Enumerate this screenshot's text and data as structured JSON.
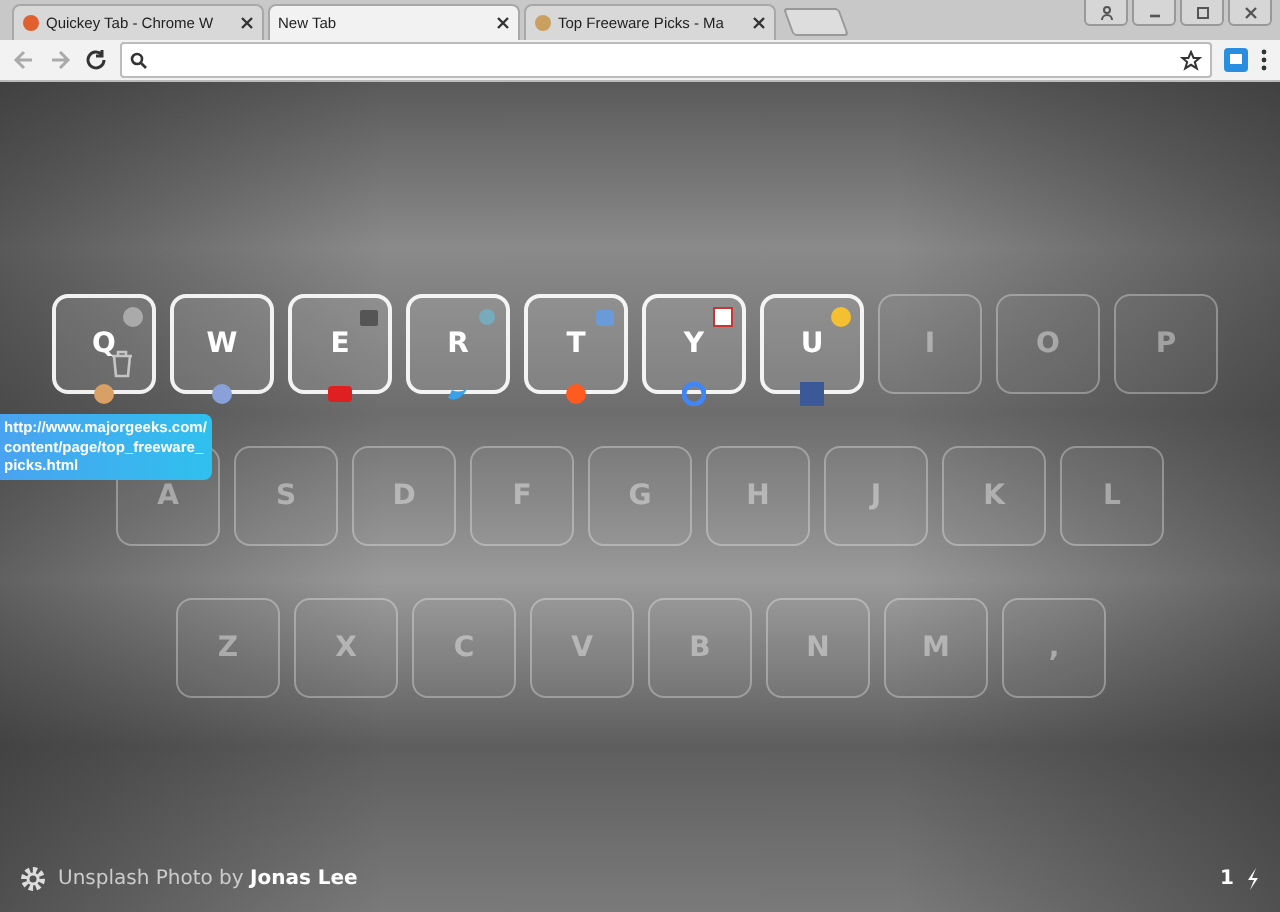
{
  "tabs": [
    {
      "title": "Quickey Tab - Chrome W",
      "selected": false
    },
    {
      "title": "New Tab",
      "selected": true
    },
    {
      "title": "Top Freeware Picks - Ma",
      "selected": false
    }
  ],
  "keyboard": [
    [
      {
        "letter": "Q",
        "assigned": true,
        "hovered": true
      },
      {
        "letter": "W",
        "assigned": true,
        "hovered": false
      },
      {
        "letter": "E",
        "assigned": true,
        "hovered": false
      },
      {
        "letter": "R",
        "assigned": true,
        "hovered": false
      },
      {
        "letter": "T",
        "assigned": true,
        "hovered": false
      },
      {
        "letter": "Y",
        "assigned": true,
        "hovered": false
      },
      {
        "letter": "U",
        "assigned": true,
        "hovered": false
      },
      {
        "letter": "I",
        "assigned": false,
        "hovered": false
      },
      {
        "letter": "O",
        "assigned": false,
        "hovered": false
      },
      {
        "letter": "P",
        "assigned": false,
        "hovered": false
      }
    ],
    [
      {
        "letter": "A",
        "assigned": false,
        "hovered": false
      },
      {
        "letter": "S",
        "assigned": false,
        "hovered": false
      },
      {
        "letter": "D",
        "assigned": false,
        "hovered": false
      },
      {
        "letter": "F",
        "assigned": false,
        "hovered": false
      },
      {
        "letter": "G",
        "assigned": false,
        "hovered": false
      },
      {
        "letter": "H",
        "assigned": false,
        "hovered": false
      },
      {
        "letter": "J",
        "assigned": false,
        "hovered": false
      },
      {
        "letter": "K",
        "assigned": false,
        "hovered": false
      },
      {
        "letter": "L",
        "assigned": false,
        "hovered": false
      }
    ],
    [
      {
        "letter": "Z",
        "assigned": false,
        "hovered": false
      },
      {
        "letter": "X",
        "assigned": false,
        "hovered": false
      },
      {
        "letter": "C",
        "assigned": false,
        "hovered": false
      },
      {
        "letter": "V",
        "assigned": false,
        "hovered": false
      },
      {
        "letter": "B",
        "assigned": false,
        "hovered": false
      },
      {
        "letter": "N",
        "assigned": false,
        "hovered": false
      },
      {
        "letter": "M",
        "assigned": false,
        "hovered": false
      },
      {
        "letter": ",",
        "assigned": false,
        "hovered": false
      }
    ]
  ],
  "tooltip": "http://www.majorgeeks.com/content/page/top_freeware_picks.html",
  "footer": {
    "credit": "Unsplash Photo by **Jonas Lee**",
    "counter": "1"
  }
}
